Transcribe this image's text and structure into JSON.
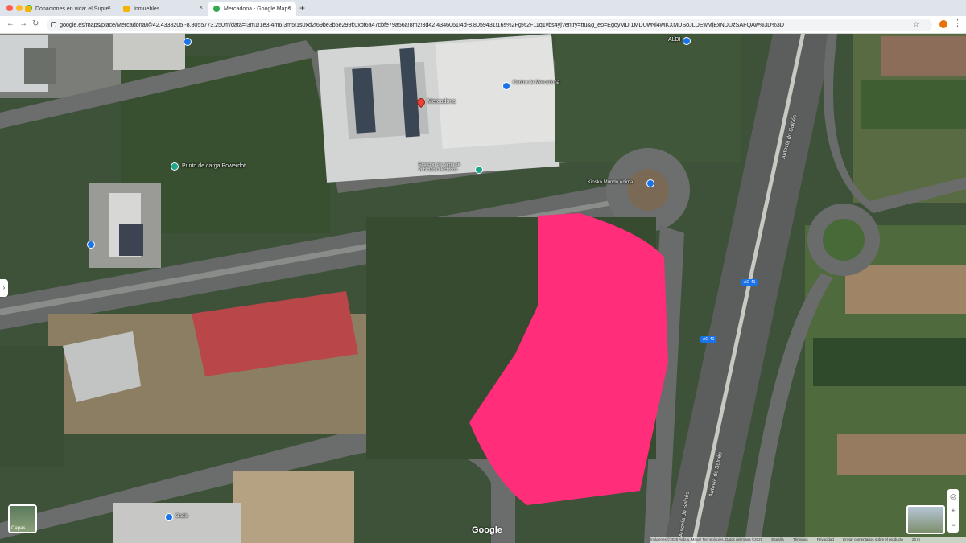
{
  "browser": {
    "tabs": [
      {
        "title": "Donaciones en vida: el Supre",
        "active": false
      },
      {
        "title": "Inmuebles",
        "active": false
      },
      {
        "title": "Mercadona - Google Maps",
        "active": true
      }
    ],
    "url": "google.es/maps/place/Mercadona/@42.4338205,-8.8055773,250m/data=!3m1!1e3!4m6!3m5!1s0xd2f69be3b5e299f:0xbf6a47cbfe79a56a!8m2!3d42.4346061!4d-8.8059431!16s%2Fg%2F11q1vbs4yj?entry=ttu&g_ep=EgoyMDI1MDUwNi4wIKXMDSoJLDEwMjExNDUzSAFQAw%3D%3D"
  },
  "map": {
    "labels": {
      "mercadona": "Mercadona",
      "powerdot": "Punto de carga Powerdot",
      "aldi": "ALDI",
      "kiosko": "Kiosko Mundo Anima",
      "charging": "Estación de carga de vehículos eléctricos",
      "centro": "Centro de Mercadona",
      "autovia_top": "Autovía do Salnés",
      "autovia_bottom": "Autovía do Salnés",
      "autovia_mid": "Autovía do Salnés",
      "bottom_business": "Gadis"
    },
    "shields": [
      "AG-41",
      "AG-41"
    ],
    "google_logo": "Google",
    "layers_label": "Capas",
    "footer": [
      "Imágenes ©2025 Airbus, Maxar Technologies, Datos del mapa ©2025",
      "España",
      "Términos",
      "Privacidad",
      "Enviar comentarios sobre el producto",
      "20 m"
    ],
    "highlight_color": "#ff2d7a"
  }
}
